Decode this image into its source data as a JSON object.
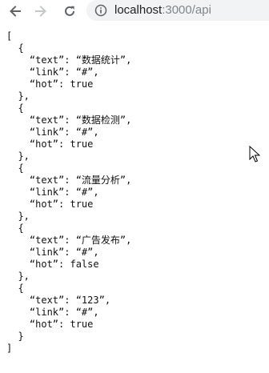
{
  "browser": {
    "url_host": "localhost",
    "url_rest": ":3000/api",
    "icons": {
      "back": "arrow-left-icon",
      "forward": "arrow-right-icon",
      "reload": "reload-icon",
      "info": "info-circle-icon",
      "cursor": "mouse-pointer-icon"
    }
  },
  "json_lines": [
    "[",
    "  {",
    "    “text”: “数据统计”,",
    "    “link”: “#”,",
    "    “hot”: true",
    "  },",
    "  {",
    "    “text”: “数据检测”,",
    "    “link”: “#”,",
    "    “hot”: true",
    "  },",
    "  {",
    "    “text”: “流量分析”,",
    "    “link”: “#”,",
    "    “hot”: true",
    "  },",
    "  {",
    "    “text”: “广告发布”,",
    "    “link”: “#”,",
    "    “hot”: false",
    "  },",
    "  {",
    "    “text”: “123”,",
    "    “link”: “#”,",
    "    “hot”: true",
    "  }",
    "]"
  ]
}
